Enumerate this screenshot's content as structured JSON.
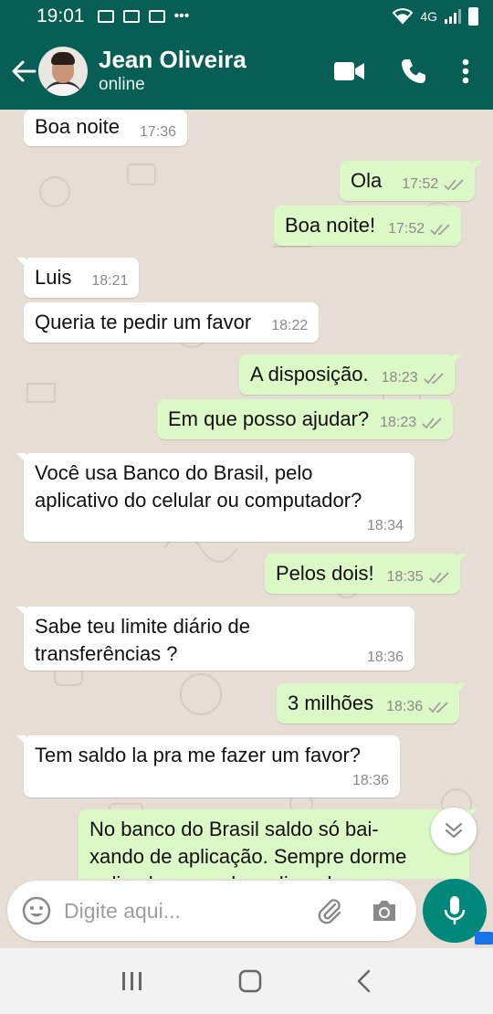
{
  "status_bar": {
    "time": "19:01",
    "network": "4G"
  },
  "header": {
    "contact_name": "Jean Oliveira",
    "contact_status": "online"
  },
  "messages": [
    {
      "side": "in",
      "text": "Boa noite",
      "time": "17:36"
    },
    {
      "side": "out",
      "text": "Ola",
      "time": "17:52"
    },
    {
      "side": "out",
      "text": "Boa noite!",
      "time": "17:52"
    },
    {
      "side": "in",
      "text": "Luis",
      "time": "18:21"
    },
    {
      "side": "in",
      "text": "Queria te pedir um favor",
      "time": "18:22"
    },
    {
      "side": "out",
      "text": "A disposição.",
      "time": "18:23"
    },
    {
      "side": "out",
      "text": "Em que posso ajudar?",
      "time": "18:23"
    },
    {
      "side": "in",
      "line1": "Você usa Banco do Brasil, pelo",
      "line2": "aplicativo do celular ou computador?",
      "time": "18:34"
    },
    {
      "side": "out",
      "text": "Pelos dois!",
      "time": "18:35"
    },
    {
      "side": "in",
      "line1": "Sabe teu limite diário de",
      "line2": "transferências ?",
      "time": "18:36"
    },
    {
      "side": "out",
      "text": "3 milhões",
      "time": "18:36"
    },
    {
      "side": "in",
      "text": "Tem saldo la pra me fazer um favor?",
      "time": "18:36"
    },
    {
      "side": "out",
      "line1": "No banco do Brasil saldo só bai-",
      "line2": "xando de aplicação. Sempre dorme",
      "line3": "aplicado e vou desaplicando"
    }
  ],
  "composer": {
    "placeholder": "Digite aqui..."
  },
  "icons": {
    "back": "arrow-left-icon",
    "video": "video-call-icon",
    "call": "phone-icon",
    "menu": "more-vert-icon",
    "emoji": "emoji-icon",
    "attach": "paperclip-icon",
    "camera": "camera-icon",
    "mic": "mic-icon",
    "scroll": "double-chevron-down-icon",
    "read": "double-check-icon"
  },
  "colors": {
    "header": "#075e54",
    "outgoing": "#dcf8c6",
    "incoming": "#ffffff",
    "accent": "#00897b",
    "tick": "#9e9e9e"
  }
}
